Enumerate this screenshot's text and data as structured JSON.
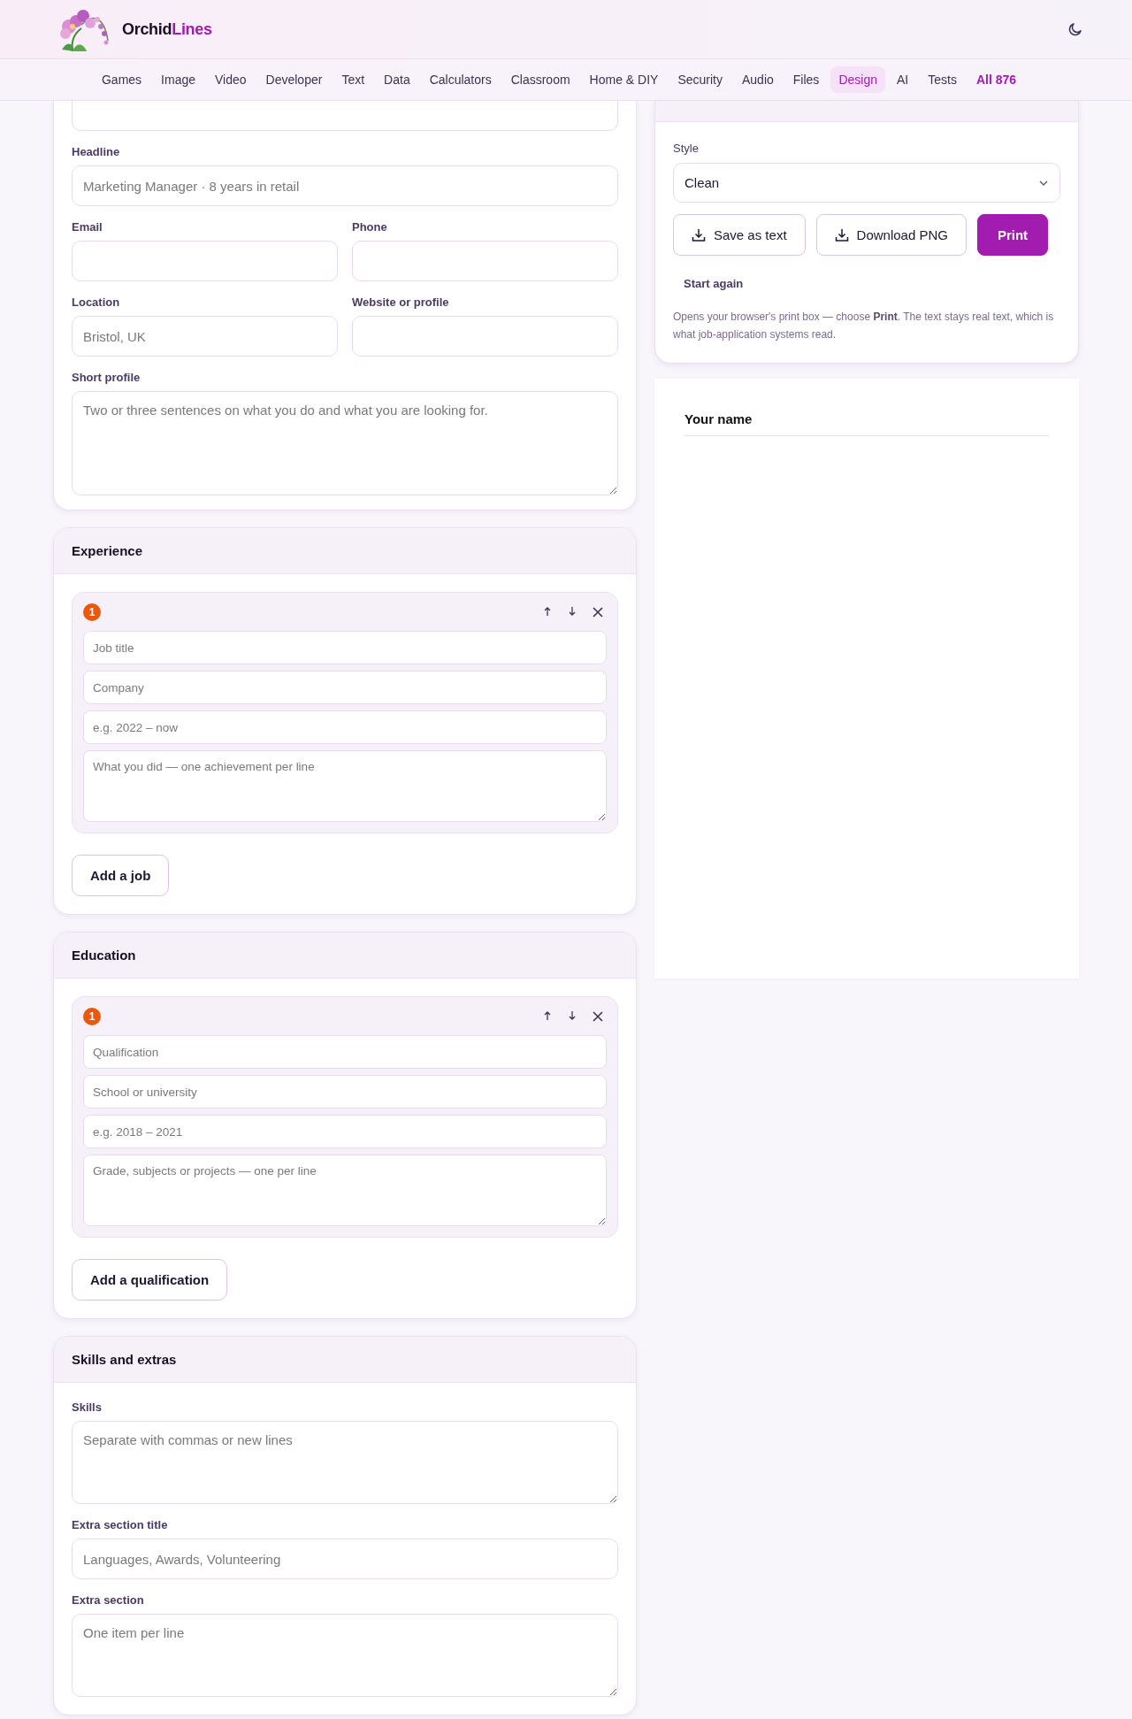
{
  "brand": {
    "name": "Orchid",
    "accent": "Lines"
  },
  "nav": [
    {
      "label": "Games",
      "selected": false,
      "kind": "link"
    },
    {
      "label": "Image",
      "selected": false,
      "kind": "link"
    },
    {
      "label": "Video",
      "selected": false,
      "kind": "link"
    },
    {
      "label": "Developer",
      "selected": false,
      "kind": "link"
    },
    {
      "label": "Text",
      "selected": false,
      "kind": "link"
    },
    {
      "label": "Data",
      "selected": false,
      "kind": "link"
    },
    {
      "label": "Calculators",
      "selected": false,
      "kind": "link"
    },
    {
      "label": "Classroom",
      "selected": false,
      "kind": "link"
    },
    {
      "label": "Home & DIY",
      "selected": false,
      "kind": "link"
    },
    {
      "label": "Security",
      "selected": false,
      "kind": "link"
    },
    {
      "label": "Audio",
      "selected": false,
      "kind": "link"
    },
    {
      "label": "Files",
      "selected": false,
      "kind": "link"
    },
    {
      "label": "Design",
      "selected": true,
      "kind": "link"
    },
    {
      "label": "AI",
      "selected": false,
      "kind": "link"
    },
    {
      "label": "Tests",
      "selected": false,
      "kind": "link"
    },
    {
      "label": "All 876",
      "selected": false,
      "kind": "all"
    }
  ],
  "profile_card": {
    "rows": [
      [
        {
          "label": "Headline",
          "placeholder": "Marketing Manager · 8 years in retail",
          "kind": "input"
        }
      ],
      [
        {
          "label": "Email",
          "kind": "input"
        },
        {
          "label": "Phone",
          "kind": "input"
        }
      ],
      [
        {
          "label": "Location",
          "placeholder": "Bristol, UK",
          "kind": "input"
        },
        {
          "label": "Website or profile",
          "kind": "input"
        }
      ],
      [
        {
          "label": "Short profile",
          "placeholder": "Two or three sentences on what you do and what you are looking for.",
          "kind": "textarea"
        }
      ]
    ]
  },
  "sections": [
    {
      "title": "Experience",
      "entries": [
        {
          "number": "1",
          "fields": [
            {
              "placeholder": "Job title",
              "kind": "input"
            },
            {
              "placeholder": "Company",
              "kind": "input"
            },
            {
              "placeholder": "e.g. 2022 – now",
              "kind": "input"
            },
            {
              "placeholder": "What you did — one achievement per line",
              "kind": "textarea"
            }
          ]
        }
      ],
      "add_button": "Add a job"
    },
    {
      "title": "Education",
      "entries": [
        {
          "number": "1",
          "fields": [
            {
              "placeholder": "Qualification",
              "kind": "input"
            },
            {
              "placeholder": "School or university",
              "kind": "input"
            },
            {
              "placeholder": "e.g. 2018 – 2021",
              "kind": "input"
            },
            {
              "placeholder": "Grade, subjects or projects — one per line",
              "kind": "textarea"
            }
          ]
        }
      ],
      "add_button": "Add a qualification"
    },
    {
      "title": "Skills and extras",
      "rows": [
        [
          {
            "label": "Skills",
            "placeholder": "Separate with commas or new lines",
            "kind": "textarea"
          }
        ],
        [
          {
            "label": "Extra section title",
            "placeholder": "Languages, Awards, Volunteering",
            "kind": "input"
          }
        ],
        [
          {
            "label": "Extra section",
            "placeholder": "One item per line",
            "kind": "textarea"
          }
        ]
      ]
    }
  ],
  "preview_panel": {
    "style_label": "Style",
    "style_value": "Clean",
    "buttons": [
      {
        "label": "Save as text",
        "kind": "download"
      },
      {
        "label": "Download PNG",
        "kind": "download"
      },
      {
        "label": "Print",
        "kind": "primary"
      }
    ],
    "reset_link": "Start again",
    "note": "Opens your browser's print box — choose **Print**. The text stays real text, which is what job-application systems read."
  },
  "preview_page": {
    "name": "Your name"
  }
}
